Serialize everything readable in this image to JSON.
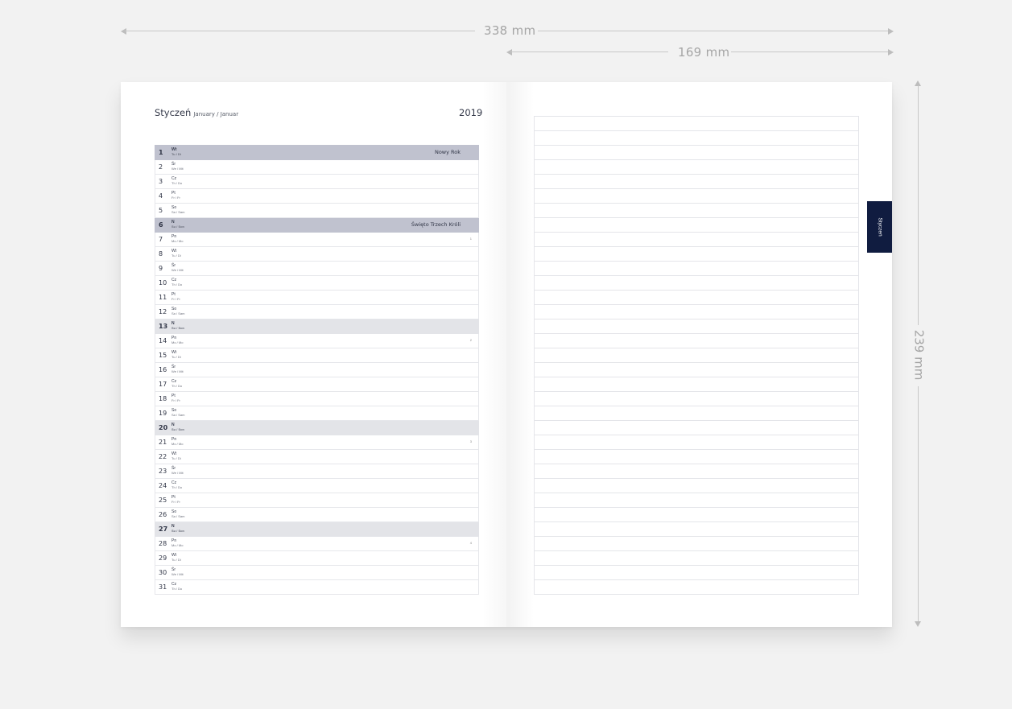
{
  "dimensions": {
    "width_label": "338 mm",
    "half_width_label": "169 mm",
    "height_label": "239 mm"
  },
  "left_page": {
    "month": "Styczeń",
    "month_translations": "January / Januar",
    "year": "2019",
    "days": [
      {
        "num": "1",
        "abbr": "Wt",
        "en": "Tu / Di",
        "type": "holiday",
        "holiday": "Nowy Rok",
        "week": ""
      },
      {
        "num": "2",
        "abbr": "Śr",
        "en": "We / Mit",
        "type": "normal",
        "holiday": "",
        "week": ""
      },
      {
        "num": "3",
        "abbr": "Cz",
        "en": "Th / Do",
        "type": "normal",
        "holiday": "",
        "week": ""
      },
      {
        "num": "4",
        "abbr": "Pt",
        "en": "Fr / Fr",
        "type": "normal",
        "holiday": "",
        "week": ""
      },
      {
        "num": "5",
        "abbr": "So",
        "en": "Sa / Sam",
        "type": "normal",
        "holiday": "",
        "week": ""
      },
      {
        "num": "6",
        "abbr": "N",
        "en": "Su / Son",
        "type": "holiday",
        "holiday": "Święto Trzech Króli",
        "week": ""
      },
      {
        "num": "7",
        "abbr": "Pn",
        "en": "Mo / Mo",
        "type": "normal",
        "holiday": "",
        "week": "1"
      },
      {
        "num": "8",
        "abbr": "Wt",
        "en": "Tu / Di",
        "type": "normal",
        "holiday": "",
        "week": ""
      },
      {
        "num": "9",
        "abbr": "Śr",
        "en": "We / Mit",
        "type": "normal",
        "holiday": "",
        "week": ""
      },
      {
        "num": "10",
        "abbr": "Cz",
        "en": "Th / Do",
        "type": "normal",
        "holiday": "",
        "week": ""
      },
      {
        "num": "11",
        "abbr": "Pt",
        "en": "Fr / Fr",
        "type": "normal",
        "holiday": "",
        "week": ""
      },
      {
        "num": "12",
        "abbr": "So",
        "en": "Sa / Sam",
        "type": "normal",
        "holiday": "",
        "week": ""
      },
      {
        "num": "13",
        "abbr": "N",
        "en": "Su / Son",
        "type": "sunday",
        "holiday": "",
        "week": ""
      },
      {
        "num": "14",
        "abbr": "Pn",
        "en": "Mo / Mo",
        "type": "normal",
        "holiday": "",
        "week": "2"
      },
      {
        "num": "15",
        "abbr": "Wt",
        "en": "Tu / Di",
        "type": "normal",
        "holiday": "",
        "week": ""
      },
      {
        "num": "16",
        "abbr": "Śr",
        "en": "We / Mit",
        "type": "normal",
        "holiday": "",
        "week": ""
      },
      {
        "num": "17",
        "abbr": "Cz",
        "en": "Th / Do",
        "type": "normal",
        "holiday": "",
        "week": ""
      },
      {
        "num": "18",
        "abbr": "Pt",
        "en": "Fr / Fr",
        "type": "normal",
        "holiday": "",
        "week": ""
      },
      {
        "num": "19",
        "abbr": "So",
        "en": "Sa / Sam",
        "type": "normal",
        "holiday": "",
        "week": ""
      },
      {
        "num": "20",
        "abbr": "N",
        "en": "Su / Son",
        "type": "sunday",
        "holiday": "",
        "week": ""
      },
      {
        "num": "21",
        "abbr": "Pn",
        "en": "Mo / Mo",
        "type": "normal",
        "holiday": "",
        "week": "3"
      },
      {
        "num": "22",
        "abbr": "Wt",
        "en": "Tu / Di",
        "type": "normal",
        "holiday": "",
        "week": ""
      },
      {
        "num": "23",
        "abbr": "Śr",
        "en": "We / Mit",
        "type": "normal",
        "holiday": "",
        "week": ""
      },
      {
        "num": "24",
        "abbr": "Cz",
        "en": "Th / Do",
        "type": "normal",
        "holiday": "",
        "week": ""
      },
      {
        "num": "25",
        "abbr": "Pt",
        "en": "Fr / Fr",
        "type": "normal",
        "holiday": "",
        "week": ""
      },
      {
        "num": "26",
        "abbr": "So",
        "en": "Sa / Sam",
        "type": "normal",
        "holiday": "",
        "week": ""
      },
      {
        "num": "27",
        "abbr": "N",
        "en": "Su / Son",
        "type": "sunday",
        "holiday": "",
        "week": ""
      },
      {
        "num": "28",
        "abbr": "Pn",
        "en": "Mo / Mo",
        "type": "normal",
        "holiday": "",
        "week": "4"
      },
      {
        "num": "29",
        "abbr": "Wt",
        "en": "Tu / Di",
        "type": "normal",
        "holiday": "",
        "week": ""
      },
      {
        "num": "30",
        "abbr": "Śr",
        "en": "We / Mit",
        "type": "normal",
        "holiday": "",
        "week": ""
      },
      {
        "num": "31",
        "abbr": "Cz",
        "en": "Th / Do",
        "type": "normal",
        "holiday": "",
        "week": ""
      }
    ]
  },
  "right_page": {
    "tab_label": "Styczeń"
  },
  "colors": {
    "holiday_row": "#c0c2cf",
    "sunday_row": "#e3e4e8",
    "tab": "#101c40"
  }
}
